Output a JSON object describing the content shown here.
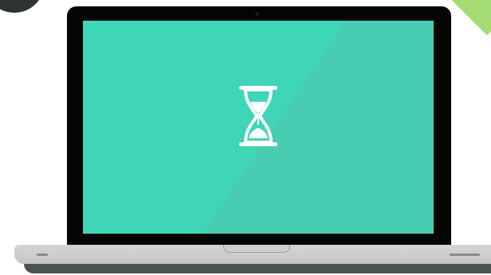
{
  "illustration": {
    "subject": "laptop-loading-hourglass",
    "icon": "hourglass-icon",
    "colors": {
      "screen": "#3ed6b7",
      "screen_glare": "#4cc9b2",
      "bezel": "#050505",
      "base": "#cfcfcf",
      "base_shadow": "#4a5252",
      "icon": "#ffffff",
      "accent_corner_left": "#2e3434",
      "accent_corner_right": "#a6dc74"
    }
  }
}
